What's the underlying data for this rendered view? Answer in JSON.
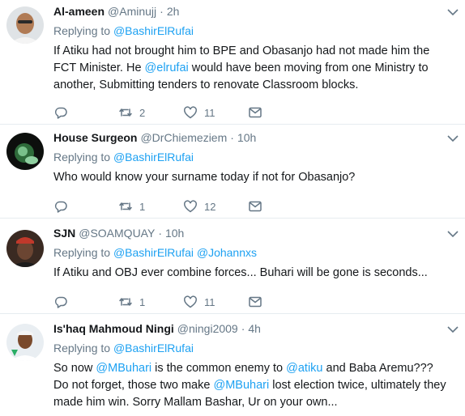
{
  "tweets": [
    {
      "name": "Al-ameen",
      "handle": "@Aminujj",
      "time": "2h",
      "replying_label": "Replying to",
      "replying_to": "@BashirElRufai",
      "text_parts": [
        {
          "t": "If Atiku had not brought him to BPE and Obasanjo had not made him the FCT Minister. He ",
          "m": false
        },
        {
          "t": "@elrufai",
          "m": true
        },
        {
          "t": " would have been moving from one Ministry to another, Submitting tenders to renovate Classroom blocks.",
          "m": false
        }
      ],
      "reply_count": "",
      "retweet_count": "2",
      "like_count": "11"
    },
    {
      "name": "House Surgeon",
      "handle": "@DrChiemeziem",
      "time": "10h",
      "replying_label": "Replying to",
      "replying_to": "@BashirElRufai",
      "text_parts": [
        {
          "t": "Who would know your surname today if not for Obasanjo?",
          "m": false
        }
      ],
      "reply_count": "",
      "retweet_count": "1",
      "like_count": "12"
    },
    {
      "name": "SJN",
      "handle": "@SOAMQUAY",
      "time": "10h",
      "replying_label": "Replying to",
      "replying_to": "@BashirElRufai @Johannxs",
      "text_parts": [
        {
          "t": "If Atiku and OBJ ever combine forces... Buhari will be gone is seconds...",
          "m": false
        }
      ],
      "reply_count": "",
      "retweet_count": "1",
      "like_count": "11"
    },
    {
      "name": "Is'haq Mahmoud Ningi",
      "handle": "@ningi2009",
      "time": "4h",
      "replying_label": "Replying to",
      "replying_to": "@BashirElRufai",
      "text_parts": [
        {
          "t": "So now ",
          "m": false
        },
        {
          "t": "@MBuhari",
          "m": true
        },
        {
          "t": " is the common enemy to ",
          "m": false
        },
        {
          "t": "@atiku",
          "m": true
        },
        {
          "t": "  and Baba Aremu??? Do not forget, those two make ",
          "m": false
        },
        {
          "t": "@MBuhari",
          "m": true
        },
        {
          "t": " lost election twice, ultimately they made him win. Sorry Mallam Bashar, Ur on your own...",
          "m": false
        }
      ],
      "reply_count": "",
      "retweet_count": "",
      "like_count": ""
    }
  ],
  "separator": "·",
  "icons": {
    "reply": "reply-icon",
    "retweet": "retweet-icon",
    "like": "heart-icon",
    "dm": "envelope-icon",
    "more": "chevron-down-icon"
  },
  "colors": {
    "link": "#1da1f2",
    "muted": "#657786",
    "text": "#14171a",
    "border": "#e6ecf0"
  }
}
